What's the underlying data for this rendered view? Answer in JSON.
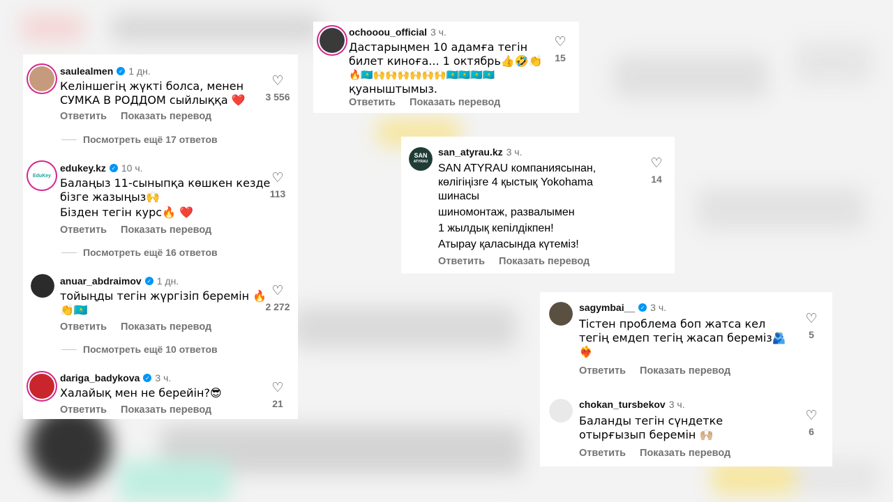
{
  "left_card": {
    "comments": [
      {
        "user": "saulealmen",
        "time": "1 дн.",
        "line1": "Келіншегің жүкті болса, менен",
        "line2": "СУМКА В РОДДОМ сыйлыққа ❤️",
        "likes": "3 556",
        "more": "Посмотреть ещё 17 ответов"
      },
      {
        "user": "edukey.kz",
        "time": "10 ч.",
        "line1": "Балаңыз 11-сыныпқа көшкен кезде",
        "line2": "бізге жазыңыз🙌",
        "line3": "Бізден тегін курс🔥 ❤️",
        "likes": "113",
        "more": "Посмотреть ещё 16 ответов",
        "avatar_text": "EduKey"
      },
      {
        "user": "anuar_abdraimov",
        "time": "1 дн.",
        "line1": "тойыңды тегін жүргізіп беремін 🔥",
        "line2": "👏🇰🇿",
        "likes": "2 272",
        "more": "Посмотреть ещё 10 ответов"
      },
      {
        "user": "dariga_badykova",
        "time": "3 ч.",
        "line1": "Халайық мен не берейін?😎",
        "likes": "21"
      }
    ]
  },
  "top_card": {
    "user": "ochooou_official",
    "time": "3 ч.",
    "line1": "Дастарыңмен 10 адамға тегін",
    "line2": "билет киноға... 1 октябрь👍🤣👏",
    "line3": "🔥🇰🇿🙌🙌🙌🙌🙌🙌🇰🇿🇰🇿🇰🇿🇰🇿",
    "line4": "қуаныштымыз.",
    "likes": "15"
  },
  "mid_card": {
    "user": "san_atyrau.kz",
    "time": "3 ч.",
    "avatar_text": "SAN",
    "avatar_sub": "ATYRAU",
    "line1": "SAN ATYRAU компаниясынан,",
    "line2": "көлігіңізге 4 қыстық Yokohama",
    "line3": "шинасы",
    "line4": "шиномонтаж, развалымен",
    "line5": "1 жылдық кепілдікпен!",
    "line6": "Атырау қаласында күтеміз!",
    "likes": "14"
  },
  "right_card": {
    "comments": [
      {
        "user": "sagymbai__",
        "time": "3 ч.",
        "line1": "Тістен проблема боп жатса кел",
        "line2": "тегің емдеп тегің жасап береміз🫂",
        "line3": "❤️‍🔥",
        "likes": "5"
      },
      {
        "user": "chokan_tursbekov",
        "time": "3 ч.",
        "line1": "Баланды тегін сүндетке",
        "line2": "отырғызып беремін 🙌🏼",
        "likes": "6"
      }
    ]
  },
  "labels": {
    "reply": "Ответить",
    "translate": "Показать перевод",
    "heart": "♡",
    "verified": "✓"
  },
  "icons": {
    "like": "heart-outline-icon",
    "verified": "verified-badge-icon"
  },
  "colors": {
    "verified": "#0095f6",
    "story_ring": "#d3288e",
    "secondary_text": "#737373"
  }
}
